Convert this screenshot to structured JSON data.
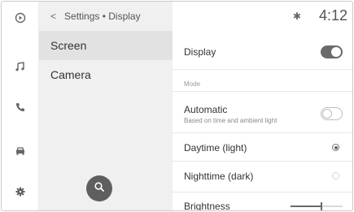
{
  "header": {
    "back_glyph": "<",
    "breadcrumb": "Settings • Display",
    "bluetooth_glyph": "✱",
    "clock": "4:12"
  },
  "rail": {
    "icons": [
      "play-circle-icon",
      "music-note-icon",
      "phone-icon",
      "car-icon",
      "gear-icon"
    ],
    "active": "gear-icon"
  },
  "menu": {
    "items": [
      {
        "label": "Screen",
        "selected": true
      },
      {
        "label": "Camera",
        "selected": false
      }
    ]
  },
  "settings": {
    "display": {
      "label": "Display",
      "on": true
    },
    "mode_section": "Mode",
    "automatic": {
      "label": "Automatic",
      "sub": "Based on time and ambient light",
      "on": false
    },
    "daytime": {
      "label": "Daytime (light)",
      "selected": true
    },
    "nighttime": {
      "label": "Nighttime (dark)",
      "selected": false
    },
    "brightness": {
      "label": "Brightness",
      "level": 0.6
    }
  },
  "colors": {
    "menu_bg": "#f0f0f0",
    "menu_active": "#e2e2e2",
    "accent": "#6a6a6a"
  }
}
